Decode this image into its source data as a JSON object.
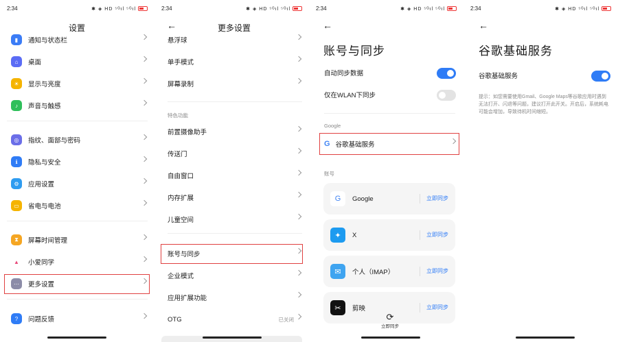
{
  "status": {
    "time": "2:34",
    "icons": "✱ ◈ HD ⁵ᴳıl ⁵ᴳıl"
  },
  "colors": {
    "accent": "#2f7cf6",
    "highlight": "#e04040"
  },
  "panel1": {
    "title": "设置",
    "items": [
      {
        "label": "通知与状态栏",
        "icon": "notification-icon",
        "color": "#3b7cf6",
        "glyph": "▮"
      },
      {
        "label": "桌面",
        "icon": "home-icon",
        "color": "#5b6cf5",
        "glyph": "⌂"
      },
      {
        "label": "显示与亮度",
        "icon": "brightness-icon",
        "color": "#f5b400",
        "glyph": "☀"
      },
      {
        "label": "声音与触感",
        "icon": "sound-icon",
        "color": "#2fbf5b",
        "glyph": "♪"
      },
      {
        "label": "指纹、面部与密码",
        "icon": "fingerprint-icon",
        "color": "#6b6ee8",
        "glyph": "◎"
      },
      {
        "label": "隐私与安全",
        "icon": "privacy-icon",
        "color": "#2f7cf6",
        "glyph": "ℹ"
      },
      {
        "label": "应用设置",
        "icon": "app-settings-icon",
        "color": "#2f9cf0",
        "glyph": "⚙"
      },
      {
        "label": "省电与电池",
        "icon": "battery-icon",
        "color": "#f5b400",
        "glyph": "▭"
      },
      {
        "label": "屏幕时间管理",
        "icon": "screen-time-icon",
        "color": "#f5a623",
        "glyph": "⧗"
      },
      {
        "label": "小爱同学",
        "icon": "assistant-icon",
        "color": "#ffffff",
        "glyph": "▲"
      },
      {
        "label": "更多设置",
        "icon": "more-settings-icon",
        "color": "#8c8ca8",
        "glyph": "⋯"
      },
      {
        "label": "问题反馈",
        "icon": "feedback-icon",
        "color": "#2f7cf6",
        "glyph": "?"
      }
    ]
  },
  "panel2": {
    "title": "更多设置",
    "section": "特色功能",
    "items": [
      {
        "label": "悬浮球",
        "value": ""
      },
      {
        "label": "单手模式",
        "value": ""
      },
      {
        "label": "屏幕录制",
        "value": ""
      },
      {
        "label": "前置摄像助手",
        "value": ""
      },
      {
        "label": "传送门",
        "value": ""
      },
      {
        "label": "自由窗口",
        "value": ""
      },
      {
        "label": "内存扩展",
        "value": ""
      },
      {
        "label": "儿童空间",
        "value": ""
      },
      {
        "label": "账号与同步",
        "value": ""
      },
      {
        "label": "企业模式",
        "value": ""
      },
      {
        "label": "应用扩展功能",
        "value": ""
      },
      {
        "label": "OTG",
        "value": "已关闭"
      }
    ]
  },
  "panel3": {
    "title": "账号与同步",
    "auto_sync": "自动同步数据",
    "wlan_sync": "仅在WLAN下同步",
    "google_section": "Google",
    "google_service": "谷歌基础服务",
    "accounts_section": "账号",
    "accounts": [
      {
        "label": "Google",
        "icon": "google-icon",
        "sync": "立即同步"
      },
      {
        "label": "X",
        "icon": "x-bird-icon",
        "sync": "立即同步"
      },
      {
        "label": "个人（IMAP）",
        "icon": "mail-icon",
        "sync": "立即同步"
      },
      {
        "label": "剪映",
        "icon": "capcut-icon",
        "sync": "立即同步"
      }
    ],
    "bottom_sync": "立即同步"
  },
  "panel4": {
    "title": "谷歌基础服务",
    "toggle_label": "谷歌基础服务",
    "hint": "提示：如您需要使用Gmail、Google Maps等谷歌应用时遇到无法打开、闪退等问题，建议打开此开关。开启后，系统耗电可能会增加，导致待机时间缩短。"
  }
}
